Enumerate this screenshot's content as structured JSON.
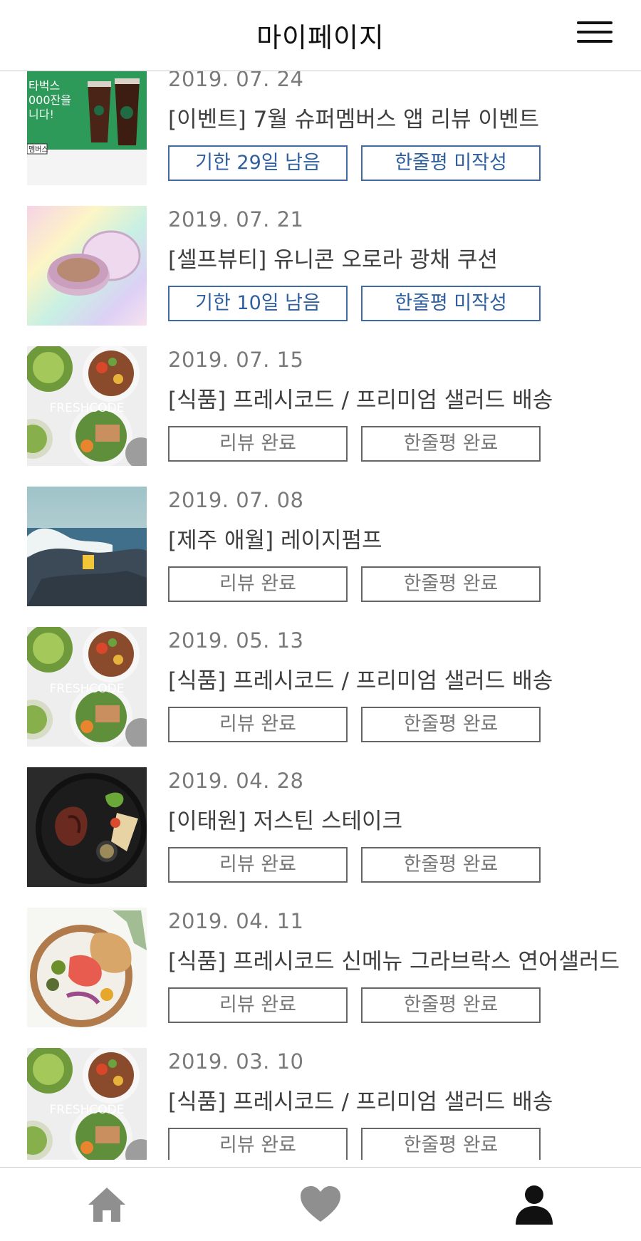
{
  "header": {
    "title": "마이페이지",
    "menu_icon": "hamburger-menu-icon"
  },
  "items": [
    {
      "date": "2019. 07. 24",
      "name": "[이벤트] 7월 슈퍼멤버스 앱 리뷰 이벤트",
      "btn1": "기한 29일 남음",
      "btn2": "한줄평 미작성",
      "active": true,
      "thumb": "starbucks",
      "thumb_text": [
        "타벅스",
        "000잔을",
        "니다!",
        "멤버스"
      ]
    },
    {
      "date": "2019. 07. 21",
      "name": "[셀프뷰티] 유니콘 오로라 광채 쿠션",
      "btn1": "기한 10일 남음",
      "btn2": "한줄평 미작성",
      "active": true,
      "thumb": "cushion",
      "thumb_text": []
    },
    {
      "date": "2019. 07. 15",
      "name": "[식품] 프레시코드 / 프리미엄 샐러드 배송",
      "btn1": "리뷰 완료",
      "btn2": "한줄평 완료",
      "active": false,
      "thumb": "salad",
      "thumb_text": [
        "FRESHCODE"
      ]
    },
    {
      "date": "2019. 07. 08",
      "name": "[제주 애월] 레이지펌프",
      "btn1": "리뷰 완료",
      "btn2": "한줄평 완료",
      "active": false,
      "thumb": "sea",
      "thumb_text": []
    },
    {
      "date": "2019. 05. 13",
      "name": "[식품] 프레시코드 / 프리미엄 샐러드 배송",
      "btn1": "리뷰 완료",
      "btn2": "한줄평 완료",
      "active": false,
      "thumb": "salad",
      "thumb_text": [
        "FRESHCODE"
      ]
    },
    {
      "date": "2019. 04. 28",
      "name": "[이태원] 저스틴 스테이크",
      "btn1": "리뷰 완료",
      "btn2": "한줄평 완료",
      "active": false,
      "thumb": "steak",
      "thumb_text": []
    },
    {
      "date": "2019. 04. 11",
      "name": "[식품] 프레시코드 신메뉴 그라브락스 연어샐러드",
      "btn1": "리뷰 완료",
      "btn2": "한줄평 완료",
      "active": false,
      "thumb": "salmon",
      "thumb_text": []
    },
    {
      "date": "2019. 03. 10",
      "name": "[식품] 프레시코드 / 프리미엄 샐러드 배송",
      "btn1": "리뷰 완료",
      "btn2": "한줄평 완료",
      "active": false,
      "thumb": "salad",
      "thumb_text": [
        "FRESHCODE"
      ]
    }
  ],
  "tabbar": [
    {
      "icon": "home-icon",
      "active": false
    },
    {
      "icon": "heart-icon",
      "active": false
    },
    {
      "icon": "user-icon",
      "active": true
    }
  ],
  "colors": {
    "active_border": "#3f6aa3",
    "active_text": "#2f5f9e",
    "inactive_icon": "#8f8f8f",
    "active_icon": "#111111"
  }
}
